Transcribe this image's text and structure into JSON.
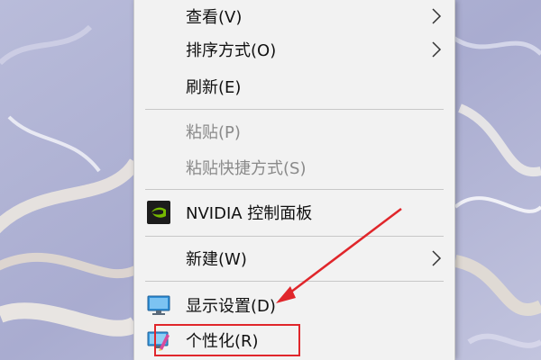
{
  "context_menu": {
    "items": [
      {
        "label": "查看(V)"
      },
      {
        "label": "排序方式(O)"
      },
      {
        "label": "刷新(E)"
      },
      {
        "label": "粘贴(P)"
      },
      {
        "label": "粘贴快捷方式(S)"
      },
      {
        "label": "NVIDIA 控制面板",
        "icon": "nvidia-icon"
      },
      {
        "label": "新建(W)"
      },
      {
        "label": "显示设置(D)",
        "icon": "display-icon"
      },
      {
        "label": "个性化(R)",
        "icon": "personalize-icon"
      }
    ]
  },
  "annotation": {
    "color": "#e0262b"
  }
}
